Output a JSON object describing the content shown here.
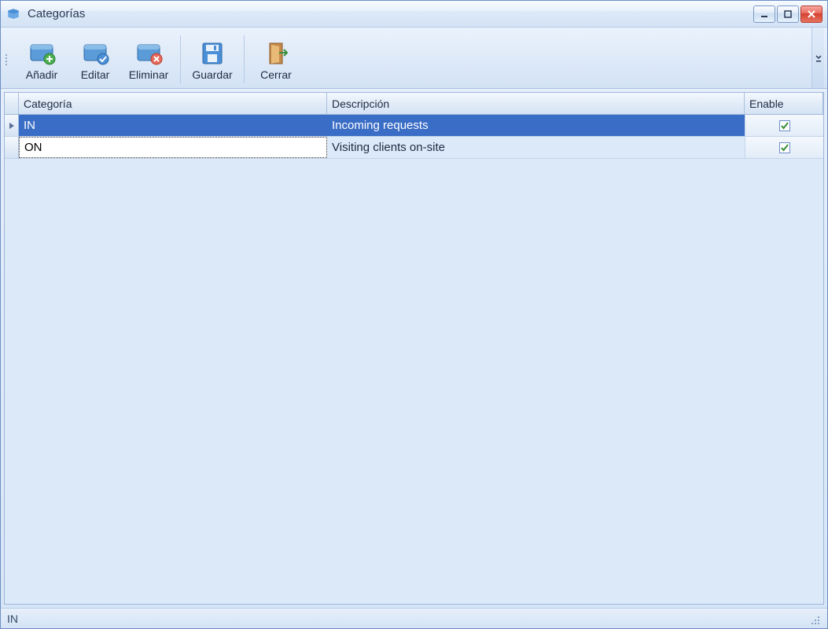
{
  "window": {
    "title": "Categorías"
  },
  "toolbar": {
    "add": "Añadir",
    "edit": "Editar",
    "delete": "Eliminar",
    "save": "Guardar",
    "close": "Cerrar"
  },
  "grid": {
    "headers": {
      "category": "Categoría",
      "description": "Descripción",
      "enable": "Enable"
    },
    "rows": [
      {
        "category": "IN",
        "description": "Incoming requests",
        "enabled": true,
        "selected": true
      },
      {
        "category": "ON",
        "description": "Visiting clients on-site",
        "enabled": true,
        "selected": false
      }
    ]
  },
  "statusbar": {
    "text": "IN"
  }
}
